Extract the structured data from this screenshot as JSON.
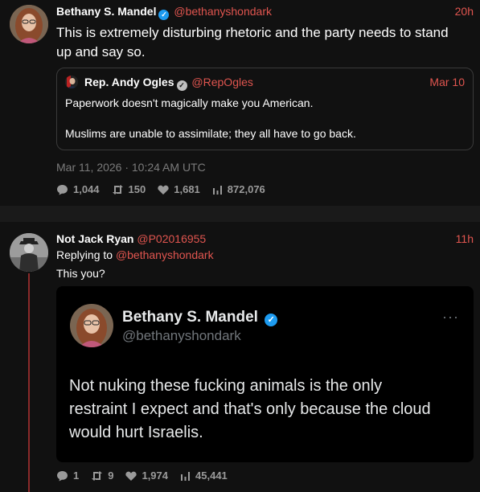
{
  "post1": {
    "author_name": "Bethany S. Mandel",
    "author_handle": "@bethanyshondark",
    "time": "20h",
    "text_line1": "This is extremely disturbing rhetoric and the party needs to stand",
    "text_line2": "up and say so.",
    "quote": {
      "author_name": "Rep. Andy Ogles",
      "author_handle": "@RepOgles",
      "date": "Mar 10",
      "line1": "Paperwork doesn't magically make you American.",
      "line2": "Muslims are unable to assimilate; they all have to go back."
    },
    "timestamp": "Mar 11, 2026 · 10:24 AM UTC",
    "stats": {
      "replies": "1,044",
      "retweets": "150",
      "likes": "1,681",
      "views": "872,076"
    }
  },
  "post2": {
    "author_name": "Not Jack Ryan",
    "author_handle": "@P02016955",
    "time": "11h",
    "replying_label": "Replying to",
    "replying_handle": "@bethanyshondark",
    "text": "This you?",
    "screenshot": {
      "author_name": "Bethany S. Mandel",
      "author_handle": "@bethanyshondark",
      "more": "···",
      "line1": "Not nuking these fucking animals is the only",
      "line2": "restraint I expect and that's only because the cloud",
      "line3": "would hurt Israelis."
    },
    "stats": {
      "replies": "1",
      "retweets": "9",
      "likes": "1,974",
      "views": "45,441"
    }
  },
  "colors": {
    "accent": "#e0554f",
    "verified": "#1d9bf0",
    "background": "#111111"
  }
}
